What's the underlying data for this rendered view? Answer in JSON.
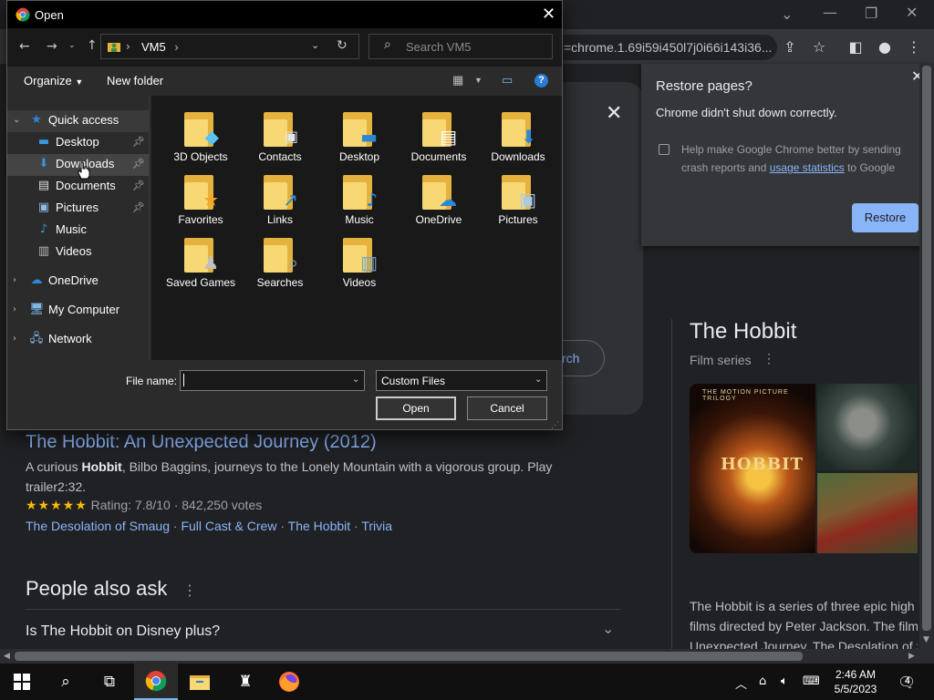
{
  "browser": {
    "omnibox_text": "=chrome.1.69i59i450l7j0i66i143i36...",
    "window_controls": [
      "chevron-down",
      "minimize",
      "restore",
      "close"
    ]
  },
  "search_result": {
    "title": "The Hobbit: An Unexpected Journey (2012)",
    "snippet_prefix": "A curious ",
    "snippet_bold": "Hobbit",
    "snippet_suffix": ", Bilbo Baggins, journeys to the Lonely Mountain with a vigorous group. Play trailer2:32.",
    "stars": "★★★★★",
    "rating_text": "Rating: 7.8/10 · 842,250 votes",
    "links": [
      "The Desolation of Smaug",
      "Full Cast & Crew",
      "The Hobbit",
      "Trivia"
    ],
    "link_separator": " · "
  },
  "people_also_ask": {
    "heading": "People also ask",
    "questions": [
      "Is The Hobbit on Disney plus?"
    ]
  },
  "card": {
    "search_button_partial": "rch"
  },
  "knowledge_panel": {
    "title": "The Hobbit",
    "subtitle": "Film series",
    "poster_tagline": "THE MOTION PICTURE TRILOGY",
    "poster_title": "HOBBIT",
    "description_lines": [
      "The Hobbit is a series of three epic high",
      "films directed by Peter Jackson. The film",
      "Unexpected Journey, The Desolation of S"
    ]
  },
  "restore_popup": {
    "title": "Restore pages?",
    "message": "Chrome didn't shut down correctly.",
    "help_prefix": "Help make Google Chrome better by sending crash reports and ",
    "help_link": "usage statistics",
    "help_suffix": " to Google",
    "restore_button": "Restore",
    "checkbox_checked": false
  },
  "dialog": {
    "title": "Open",
    "address": {
      "path": [
        "VM5"
      ],
      "separator": "›"
    },
    "search_placeholder": "Search VM5",
    "commands": {
      "organize": "Organize",
      "new_folder": "New folder"
    },
    "nav_items": [
      {
        "label": "Quick access",
        "icon": "star-icon",
        "level": 0,
        "expanded": true,
        "selected": true
      },
      {
        "label": "Desktop",
        "icon": "desktop-icon",
        "level": 1,
        "pinned": true
      },
      {
        "label": "Downloads",
        "icon": "downloads-icon",
        "level": 1,
        "pinned": true,
        "hovered": true
      },
      {
        "label": "Documents",
        "icon": "documents-icon",
        "level": 1,
        "pinned": true
      },
      {
        "label": "Pictures",
        "icon": "pictures-icon",
        "level": 1,
        "pinned": true
      },
      {
        "label": "Music",
        "icon": "music-icon",
        "level": 1
      },
      {
        "label": "Videos",
        "icon": "videos-icon",
        "level": 1
      },
      {
        "label": "OneDrive",
        "icon": "onedrive-icon",
        "level": 0,
        "expanded": false
      },
      {
        "label": "My Computer",
        "icon": "computer-icon",
        "level": 0,
        "expanded": false
      },
      {
        "label": "Network",
        "icon": "network-icon",
        "level": 0,
        "expanded": false
      }
    ],
    "folders": [
      {
        "label": "3D Objects",
        "overlay": "cube"
      },
      {
        "label": "Contacts",
        "overlay": "contact-card"
      },
      {
        "label": "Desktop",
        "overlay": "monitor"
      },
      {
        "label": "Documents",
        "overlay": "document"
      },
      {
        "label": "Downloads",
        "overlay": "down-arrow"
      },
      {
        "label": "Favorites",
        "overlay": "star"
      },
      {
        "label": "Links",
        "overlay": "link-arrow"
      },
      {
        "label": "Music",
        "overlay": "music-note"
      },
      {
        "label": "OneDrive",
        "overlay": "cloud"
      },
      {
        "label": "Pictures",
        "overlay": "landscape"
      },
      {
        "label": "Saved Games",
        "overlay": "chess-piece"
      },
      {
        "label": "Searches",
        "overlay": "magnifier"
      },
      {
        "label": "Videos",
        "overlay": "film"
      }
    ],
    "file_name_label": "File name:",
    "file_name_value": "",
    "file_type": "Custom Files",
    "open_button": "Open",
    "cancel_button": "Cancel"
  },
  "taskbar": {
    "time": "2:46 AM",
    "date": "5/5/2023",
    "notification_count": "4"
  },
  "colors": {
    "link": "#8ab4f8",
    "folder": "#f8d775",
    "accent": "#76b9ed",
    "restore_button": "#8ab4f8"
  }
}
